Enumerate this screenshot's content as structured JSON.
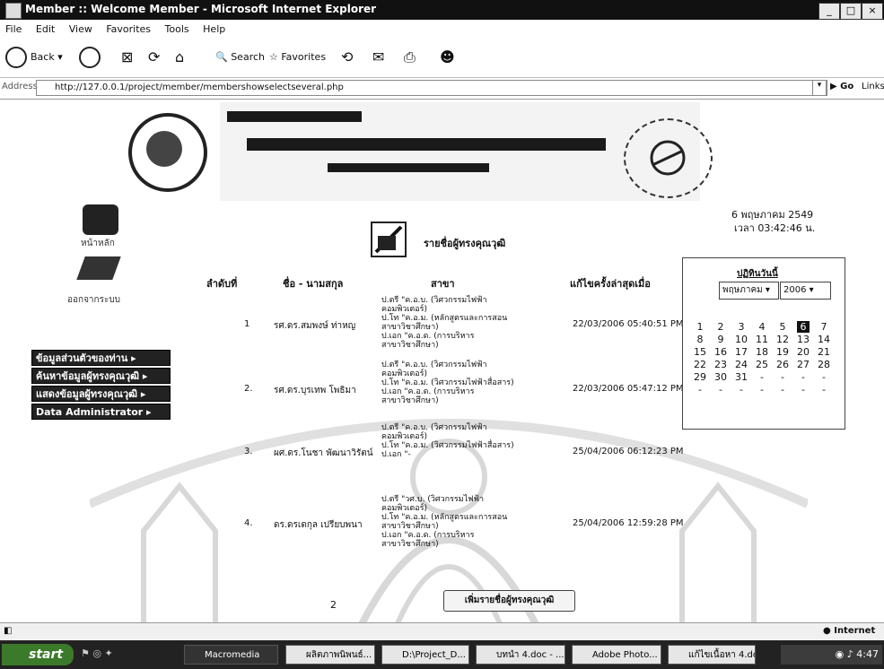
{
  "window": {
    "title": "Member :: Welcome Member - Microsoft Internet Explorer"
  },
  "menu": [
    "File",
    "Edit",
    "View",
    "Favorites",
    "Tools",
    "Help"
  ],
  "toolbar": {
    "back_label": "Back",
    "search_label": "Search",
    "favorites_label": "Favorites"
  },
  "address": {
    "label": "Address",
    "url": "http://127.0.0.1/project/member/membershowselectseveral.php",
    "go_label": "Go",
    "links_label": "Links"
  },
  "nav": {
    "home_label": "หน้าหลัก",
    "logout_label": "ออกจากระบบ"
  },
  "side_menu": [
    "ข้อมูลส่วนตัวของท่าน",
    "ค้นหาข้อมูลผู้ทรงคุณวุฒิ",
    "แสดงข้อมูลผู้ทรงคุณวุฒิ",
    "Data Administrator"
  ],
  "section_title": "รายชื่อผู้ทรงคุณวุฒิ",
  "table": {
    "headers": [
      "ลำดับที่",
      "ชื่อ - นามสกุล",
      "สาขา",
      "แก้ไขครั้งล่าสุดเมื่อ"
    ],
    "rows": [
      {
        "no": "1",
        "name": "รศ.ดร.สมพงษ์  ท่าหญ",
        "majors": [
          "ป.ตรี \"ค.อ.บ. (วิศวกรรมไฟฟ้า",
          "คอมพิวเตอร์)",
          "ป.โท \"ค.อ.ม. (หลักสูตรและการสอน",
          "สาขาวิชาศึกษา)",
          "ป.เอก \"ค.อ.ด. (การบริหาร",
          "สาขาวิชาศึกษา)"
        ],
        "updated": "22/03/2006  05:40:51 PM"
      },
      {
        "no": "2.",
        "name": "รศ.ดร.บุรเทพ  โพธิมา",
        "majors": [
          "ป.ตรี \"ค.อ.บ. (วิศวกรรมไฟฟ้า",
          "คอมพิวเตอร์)",
          "ป.โท \"ค.อ.ม. (วิศวกรรมไฟฟ้าสื่อสาร)",
          "ป.เอก \"ค.อ.ด. (การบริหาร",
          "สาขาวิชาศึกษา)"
        ],
        "updated": "22/03/2006  05:47:12 PM"
      },
      {
        "no": "3.",
        "name": "ผศ.ดร.โนชา  พัฒนาวิรัตน์",
        "majors": [
          "ป.ตรี \"ค.อ.บ. (วิศวกรรมไฟฟ้า",
          "คอมพิวเตอร์)",
          "ป.โท \"ค.อ.ม. (วิศวกรรมไฟฟ้าสื่อสาร)",
          "ป.เอก \"-"
        ],
        "updated": "25/04/2006  06:12:23 PM"
      },
      {
        "no": "4.",
        "name": "ดร.ดรเดกุล  เปรียบพนา",
        "majors": [
          "ป.ตรี \"วศ.บ. (วิศวกรรมไฟฟ้า",
          "คอมพิวเตอร์)",
          "ป.โท \"ค.อ.ม. (หลักสูตรและการสอน",
          "สาขาวิชาศึกษา)",
          "ป.เอก \"ค.อ.ด. (การบริหาร",
          "สาขาวิชาศึกษา)"
        ],
        "updated": "25/04/2006  12:59:28 PM"
      }
    ]
  },
  "date_text": "6 พฤษภาคม 2549",
  "time_text": "เวลา 03:42:46 น.",
  "calendar": {
    "title": "ปฏิทินวันนี้",
    "month": "พฤษภาคม",
    "year": "2006",
    "weeks": [
      [
        "1",
        "2",
        "3",
        "4",
        "5",
        "6",
        "7"
      ],
      [
        "8",
        "9",
        "10",
        "11",
        "12",
        "13",
        "14"
      ],
      [
        "15",
        "16",
        "17",
        "18",
        "19",
        "20",
        "21"
      ],
      [
        "22",
        "23",
        "24",
        "25",
        "26",
        "27",
        "28"
      ],
      [
        "29",
        "30",
        "31",
        "-",
        "-",
        "-",
        "-"
      ],
      [
        "-",
        "-",
        "-",
        "-",
        "-",
        "-",
        "-"
      ]
    ],
    "selected_day": "6"
  },
  "pager": {
    "page": "2",
    "add_button": "เพิ่มรายชื่อผู้ทรงคุณวุฒิ"
  },
  "status": {
    "zone": "Internet"
  },
  "taskbar": {
    "start": "start",
    "items": [
      "Macromedia",
      "ผลิตภาพนิพนธ์...",
      "D:\\Project_D...",
      "บทนำ 4.doc - ...",
      "Adobe Photo...",
      "แก้ไขเนื้อหา 4.do..."
    ],
    "clock": "4:47"
  },
  "colors": {
    "titlebar": "#111111",
    "sidebtn": "#222222",
    "taskbar": "#222222",
    "start": "#3a7a2a"
  }
}
